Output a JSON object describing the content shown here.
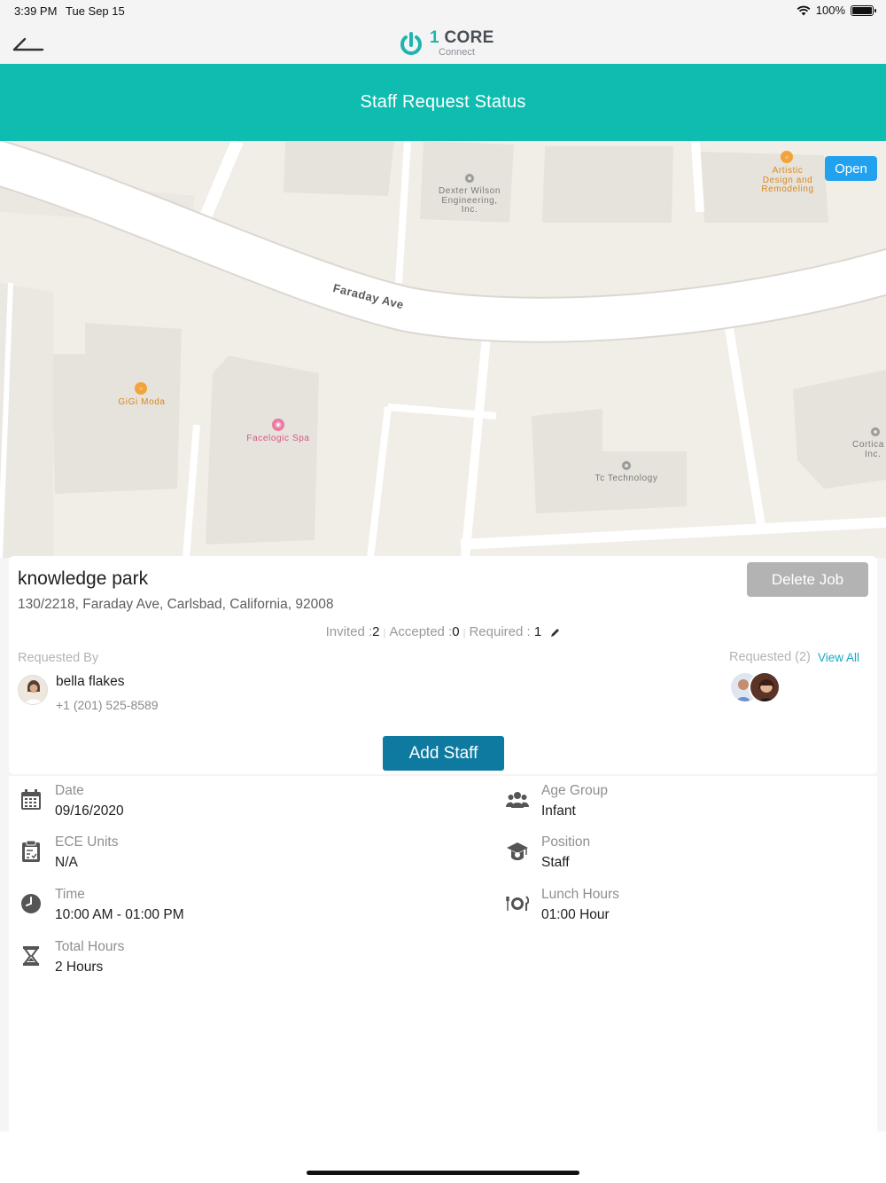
{
  "status_bar": {
    "time": "3:39 PM",
    "date": "Tue Sep 15",
    "battery": "100%"
  },
  "nav": {
    "logo_number": "1",
    "logo_word": "CORE",
    "logo_sub": "Connect"
  },
  "header": {
    "title": "Staff Request Status"
  },
  "map": {
    "street": "Faraday Ave",
    "open_label": "Open",
    "places": [
      "Dexter Wilson Engineering, Inc.",
      "Artistic Design and Remodeling",
      "GiGi Moda",
      "Facelogic Spa",
      "Tc Technology",
      "Cortica Inc."
    ],
    "place_lines": {
      "dexter": [
        "Dexter Wilson",
        "Engineering,",
        "Inc."
      ],
      "artistic": [
        "Artistic",
        "Design and",
        "Remodeling"
      ],
      "gigi": [
        "GiGi Moda"
      ],
      "facelogic": [
        "Facelogic Spa"
      ],
      "tc": [
        "Tc Technology"
      ],
      "cortica": [
        "Cortica",
        "Inc."
      ]
    }
  },
  "job": {
    "site_name": "knowledge park",
    "address": "130/2218, Faraday Ave, Carlsbad, California, 92008",
    "delete_label": "Delete Job",
    "invited_label": "Invited :",
    "invited_value": "2",
    "accepted_label": "Accepted :",
    "accepted_value": "0",
    "required_label": "Required :",
    "required_value": "1",
    "requested_by_label": "Requested By",
    "requester_name": "bella flakes",
    "requester_phone": "+1 (201) 525-8589",
    "requested_label": "Requested (2)",
    "view_all_label": "View All",
    "add_staff_label": "Add Staff"
  },
  "details": {
    "date_label": "Date",
    "date_value": "09/16/2020",
    "ece_label": "ECE Units",
    "ece_value": "N/A",
    "time_label": "Time",
    "time_value": "10:00 AM - 01:00 PM",
    "total_label": "Total Hours",
    "total_value": "2 Hours",
    "age_label": "Age Group",
    "age_value": "Infant",
    "position_label": "Position",
    "position_value": "Staff",
    "lunch_label": "Lunch Hours",
    "lunch_value": "01:00 Hour"
  },
  "colors": {
    "teal_header": "#0fbcb0",
    "add_staff": "#0e7aa0",
    "open_button": "#22a2ee",
    "delete_button": "#b3b3b3",
    "link": "#17a8c8"
  },
  "icons": {
    "back": "back-arrow-icon",
    "logo": "power-icon",
    "wifi": "wifi-icon",
    "battery": "battery-icon",
    "date": "calendar-icon",
    "ece": "clipboard-icon",
    "time": "clock-icon",
    "total": "hourglass-icon",
    "age": "people-icon",
    "position": "graduation-cap-icon",
    "lunch": "plate-cutlery-icon",
    "edit": "pencil-icon"
  }
}
